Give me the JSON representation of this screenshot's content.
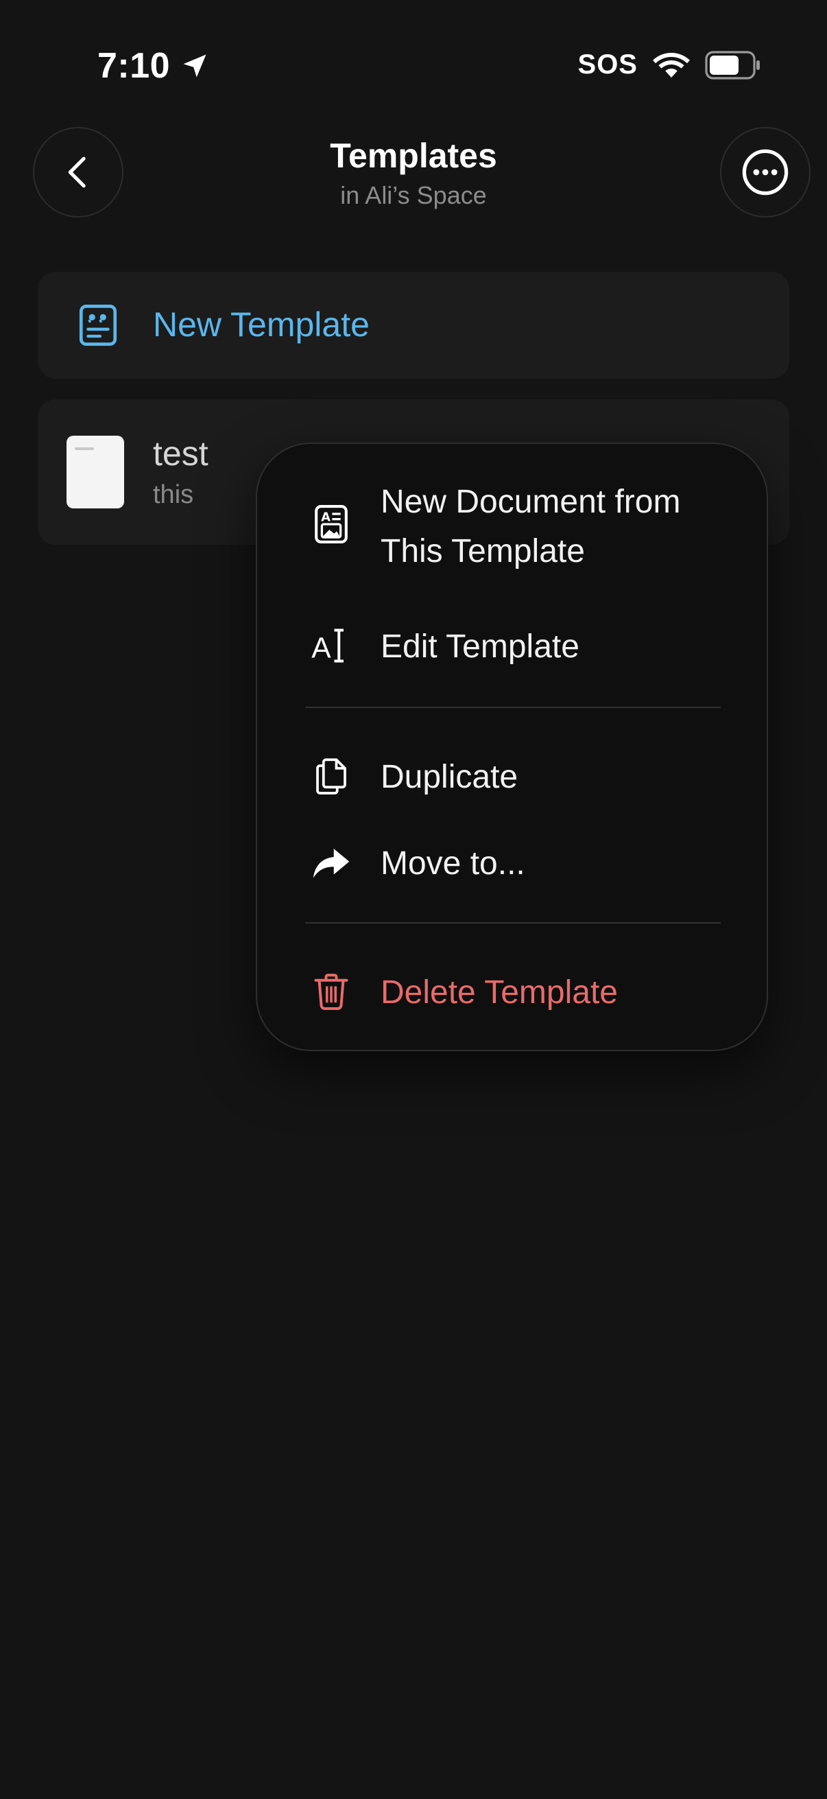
{
  "status_bar": {
    "time": "7:10",
    "sos": "SOS"
  },
  "header": {
    "title": "Templates",
    "subtitle": "in Ali’s Space"
  },
  "new_template": {
    "label": "New Template"
  },
  "templates": [
    {
      "title": "test",
      "subtitle": "this"
    }
  ],
  "context_menu": {
    "new_document_line1": "New Document from",
    "new_document_line2": "This Template",
    "edit": "Edit Template",
    "duplicate": "Duplicate",
    "move": "Move to...",
    "delete": "Delete Template"
  },
  "colors": {
    "accent": "#5ab7ec",
    "danger": "#eb6a6a",
    "background": "#141414"
  }
}
